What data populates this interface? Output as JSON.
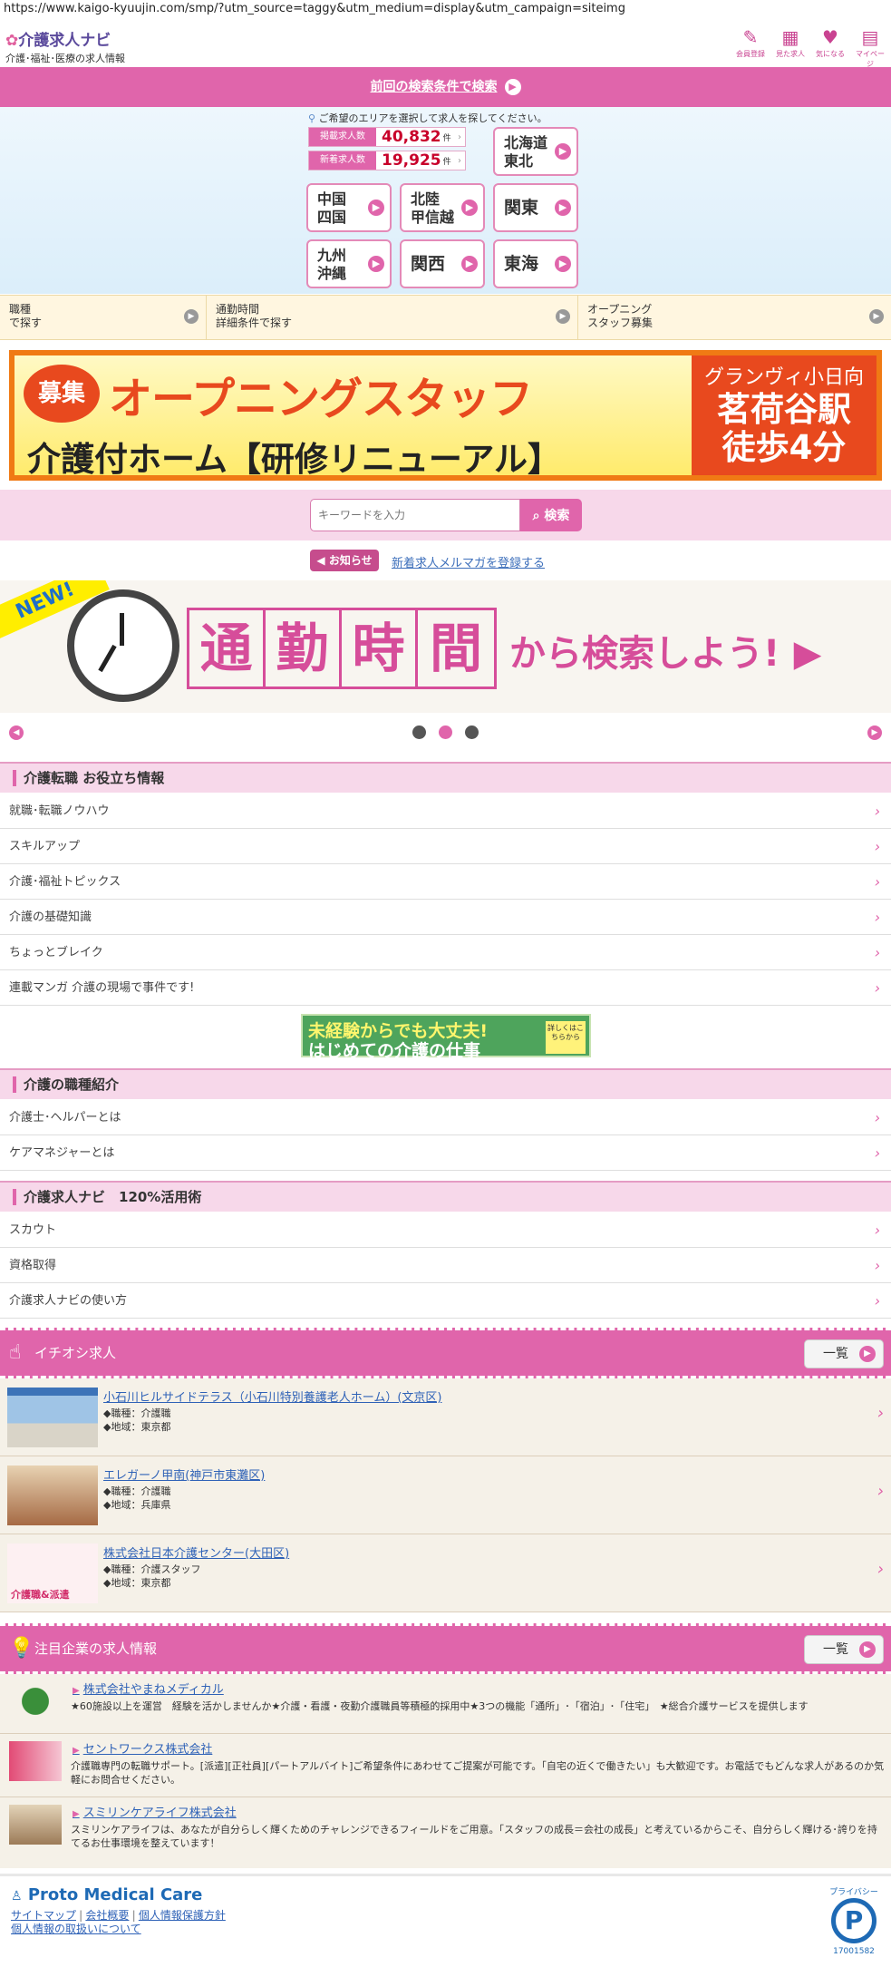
{
  "browser": {
    "url": "https://www.kaigo-kyuujin.com/smp/?utm_source=taggy&utm_medium=display&utm_campaign=siteimg"
  },
  "header": {
    "logo_text": "介護求人ナビ",
    "logo_sub": "介護･福祉･医療の求人情報",
    "icons": [
      {
        "label": "会員登録",
        "icon": "pen-icon"
      },
      {
        "label": "見た求人",
        "icon": "calendar-icon"
      },
      {
        "label": "気になる",
        "icon": "heart-icon"
      },
      {
        "label": "マイページ",
        "icon": "mypage-icon"
      }
    ]
  },
  "prev_search": {
    "label": "前回の検索条件で検索"
  },
  "area": {
    "note": "ご希望のエリアを選択して求人を探してください。",
    "stats": [
      {
        "label": "掲載求人数",
        "value": "40,832",
        "unit": "件"
      },
      {
        "label": "新着求人数",
        "value": "19,925",
        "unit": "件"
      }
    ],
    "regions": [
      {
        "line1": "北海道",
        "line2": "東北"
      },
      {
        "line1": "中国",
        "line2": "四国"
      },
      {
        "line1": "北陸",
        "line2": "甲信越"
      },
      {
        "line1": "関東",
        "line2": ""
      },
      {
        "line1": "九州",
        "line2": "沖縄"
      },
      {
        "line1": "関西",
        "line2": ""
      },
      {
        "line1": "東海",
        "line2": ""
      }
    ]
  },
  "search_row": [
    {
      "line1": "職種",
      "line2": "で探す"
    },
    {
      "line1": "通勤時間",
      "line2": "詳細条件で探す"
    },
    {
      "line1": "オープニング",
      "line2": "スタッフ募集"
    }
  ],
  "banner": {
    "tag": "募集",
    "title": "オープニングスタッフ",
    "subtitle": "介護付ホーム【研修リニューアル】",
    "facility": "グランヴィ小日向",
    "station": "茗荷谷駅",
    "walk": "徒歩4分"
  },
  "keyword": {
    "placeholder": "キーワードを入力",
    "button": "検索"
  },
  "notice": {
    "tag": "お知らせ",
    "link": "新着求人メルマガを登録する"
  },
  "slide": {
    "badge": "NEW!",
    "chars": [
      "通",
      "勤",
      "時",
      "間"
    ],
    "text": "から検索しよう!",
    "arrow": "▶"
  },
  "section1": {
    "title": "介護転職 お役立ち情報",
    "items": [
      "就職･転職ノウハウ",
      "スキルアップ",
      "介護･福祉トピックス",
      "介護の基礎知識",
      "ちょっとブレイク",
      "連載マンガ 介護の現場で事件です!"
    ]
  },
  "mid_banner": {
    "line1": "未経験からでも大丈夫!",
    "line2": "はじめての介護の仕事",
    "side": "詳しくはこちらから"
  },
  "section2": {
    "title": "介護の職種紹介",
    "items": [
      "介護士･ヘルパーとは",
      "ケアマネジャーとは"
    ]
  },
  "section3": {
    "title": "介護求人ナビ　120%活用術",
    "items": [
      "スカウト",
      "資格取得",
      "介護求人ナビの使い方"
    ]
  },
  "pickup": {
    "title": "イチオシ求人",
    "list_button": "一覧",
    "jobs": [
      {
        "title": "小石川ヒルサイドテラス（小石川特別養護老人ホーム）(文京区)",
        "job": "◆職種：介護職",
        "area": "◆地域：東京都"
      },
      {
        "title": "エレガーノ甲南(神戸市東灘区)",
        "job": "◆職種：介護職",
        "area": "◆地域：兵庫県"
      },
      {
        "title": "株式会社日本介護センター(大田区)",
        "job": "◆職種：介護スタッフ",
        "area": "◆地域：東京都"
      }
    ],
    "job3_img_text": "介護職&派遣"
  },
  "companies": {
    "title": "注目企業の求人情報",
    "list_button": "一覧",
    "items": [
      {
        "name": "株式会社やまねメディカル",
        "desc": "★60施設以上を運営　経験を活かしませんか★介護・看護・夜勤介護職員等積極的採用中★3つの機能「通所」･「宿泊」･「住宅」　★総合介護サービスを提供します"
      },
      {
        "name": "セントワークス株式会社",
        "desc": "介護職専門の転職サポート。[派遣][正社員][パートアルバイト]ご希望条件にあわせてご提案が可能です。「自宅の近くで働きたい」も大歓迎です。お電話でもどんな求人があるのか気軽にお問合せください。"
      },
      {
        "name": "スミリンケアライフ株式会社",
        "desc": "スミリンケアライフは、あなたが自分らしく輝くためのチャレンジできるフィールドをご用意。「スタッフの成長＝会社の成長」と考えているからこそ、自分らしく輝ける･誇りを持てるお仕事環境を整えています！"
      }
    ]
  },
  "footer": {
    "brand": "Proto Medical Care",
    "links": [
      "サイトマップ",
      "会社概要",
      "個人情報保護方針",
      "個人情報の取扱いについて"
    ],
    "privacy_top": "プライバシー",
    "privacy_num": "17001582"
  },
  "colors": {
    "accent": "#e065ab",
    "link": "#2f62b7",
    "banner": "#f07a14"
  }
}
